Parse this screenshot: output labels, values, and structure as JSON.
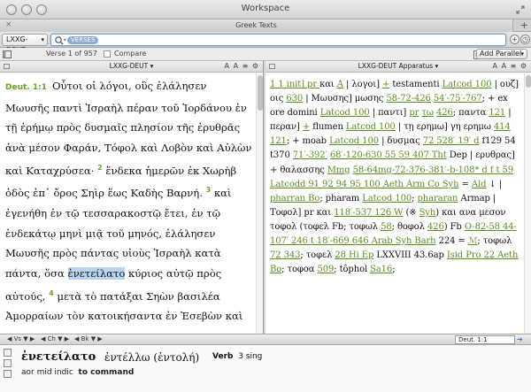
{
  "window": {
    "title": "Workspace",
    "tab_label": "Greek Texts",
    "tab_close": "×",
    "tab_add": "+"
  },
  "toolbar": {
    "resource": "LXXG-DEUT",
    "search_chip": "VERSES"
  },
  "status": {
    "verse_info": "Verse 1 of 957",
    "compare_label": "Compare",
    "add_parallel_label": "Add Parallel"
  },
  "left_pane": {
    "title": "LXXG-DEUT",
    "tools": "A A ≡ ⚙",
    "ref": "Deut. 1:1",
    "segments": [
      {
        "t": "Οὗτοι οἱ λόγοι, οὓς ἐλάλησεν Μωυσῆς"
      },
      {
        "t": "παντὶ Ἰσραὴλ πέραν τοῦ Ἰορδάνου ἐν τῇ"
      },
      {
        "t": "ἐρήμῳ πρὸς δυσμαῖς πλησίον τῆς ἐρυθρᾶς ἀνὰ"
      },
      {
        "t": "μέσον Φαράν, Τόφολ καὶ Λοβὸν καὶ Αὐλὼν"
      },
      {
        "t": "καὶ Καταχρύσεα·"
      }
    ],
    "verses": [
      {
        "n": "2",
        "t": "ἕνδεκα ἡμερῶν ἐκ Χωρὴβ ὁδὸς ἐπ᾽ ὄρος Σηὶρ ἕως Καδὴς Βαρνή."
      },
      {
        "n": "3",
        "t": "καὶ ἐγενήθη ἐν τῷ τεσσαρακοστῷ ἔτει, ἐν τῷ ἑνδεκάτῳ μηνὶ μιᾷ τοῦ μηνός, ἐλάλησεν Μωυσῆς πρὸς πάντας υἱοὺς Ἰσραὴλ κατὰ πάντα, ὅσα"
      },
      {
        "n": "",
        "t": "ἐνετείλατο",
        "highlight": true
      },
      {
        "n": "",
        "t": "κύριος αὐτῷ πρὸς αὐτούς,"
      },
      {
        "n": "4",
        "t": "μετὰ τὸ πατάξαι Σηὼν βασιλέα Ἀμορραίων τὸν κατοικήσαντα ἐν Ἐσεβὼν καὶ"
      }
    ]
  },
  "right_pane": {
    "title": "LXXG-DEUT Apparatus",
    "tools": "A A ≡ ⚙",
    "text_segments": [
      {
        "t": "1 1 init] ",
        "u": true
      },
      {
        "t": "pr ",
        "u": true
      },
      {
        "t": "και "
      },
      {
        "t": "A",
        "u": true
      },
      {
        "t": " | λογοι] "
      },
      {
        "t": "+",
        "u": true
      },
      {
        "t": " testamenti "
      },
      {
        "t": "Latcod 100",
        "u": true
      },
      {
        "t": " | ουζ] οις "
      },
      {
        "t": "630",
        "u": true
      },
      {
        "t": " | Μωυσης] μωσης "
      },
      {
        "t": "58-72-426",
        "u": true
      },
      {
        "t": " "
      },
      {
        "t": "54′-75′-767",
        "u": true
      },
      {
        "t": "; + ex ore domini "
      },
      {
        "t": "Latcod 100",
        "u": true
      },
      {
        "t": " | παντι] "
      },
      {
        "t": "pr",
        "u": true
      },
      {
        "t": " "
      },
      {
        "t": "τω",
        "u": true
      },
      {
        "t": " "
      },
      {
        "t": "426",
        "u": true
      },
      {
        "t": "; παντα "
      },
      {
        "t": "121",
        "u": true
      },
      {
        "t": " | περαν] "
      },
      {
        "t": "+",
        "u": true
      },
      {
        "t": " flumen "
      },
      {
        "t": "Latcod 100",
        "u": true
      },
      {
        "t": " | τῃ "
      },
      {
        "t": "ερημω] γη ερημω "
      },
      {
        "t": "414 121",
        "u": true
      },
      {
        "t": "; + moab "
      },
      {
        "t": "Latcod 100",
        "u": true
      },
      {
        "t": " | "
      },
      {
        "t": "δυσμας "
      },
      {
        "t": "72 528′ 19′ d",
        "u": true
      },
      {
        "t": " f129 54 t370 "
      },
      {
        "t": "71′-392′",
        "u": true
      },
      {
        "t": " "
      },
      {
        "t": "68′-120-630 55 59 407 Tht",
        "u": true
      },
      {
        "t": " Dep | ερυθρας] + "
      },
      {
        "t": "θαλασσης "
      },
      {
        "t": "Mmg",
        "u": true
      },
      {
        "t": " "
      },
      {
        "t": "58-64mg-72-376-381′-b-108* d f t 59",
        "u": true
      },
      {
        "t": " "
      },
      {
        "t": "Latcodd 91 92 94 95 100 Aeth Arm Co Syh",
        "u": true
      },
      {
        "t": " = "
      },
      {
        "t": "Ald",
        "u": true
      },
      {
        "t": " ↓ | "
      },
      {
        "t": "pharran Bo",
        "u": true
      },
      {
        "t": "; pharam "
      },
      {
        "t": "Latcod 100",
        "u": true
      },
      {
        "t": "; "
      },
      {
        "t": "phararan",
        "u": true
      },
      {
        "t": " Armap | "
      },
      {
        "t": "Τοφολ] pr και "
      },
      {
        "t": "118′-537 126 W",
        "u": true
      },
      {
        "t": " (※ "
      },
      {
        "t": "Syh",
        "u": true
      },
      {
        "t": ") και ανα "
      },
      {
        "t": "μεσον τοφολ (τοφελ Fb; τοφωλ "
      },
      {
        "t": "58",
        "u": true
      },
      {
        "t": "; θοφολ "
      },
      {
        "t": "426",
        "u": true
      },
      {
        "t": ") Fb "
      },
      {
        "t": "O-82-58 44-107′ 246 t 18′-669 646 Arab Syh Barh",
        "u": true
      },
      {
        "t": " 224 "
      },
      {
        "t": "= "
      },
      {
        "t": "ℳ",
        "u": true
      },
      {
        "t": "; τοφωλ "
      },
      {
        "t": "72 343",
        "u": true
      },
      {
        "t": "; τοφελ "
      },
      {
        "t": "28 Hi Ep",
        "u": true
      },
      {
        "t": " LXXVIII "
      },
      {
        "t": "43.6ap "
      },
      {
        "t": "Isid Pro 22 Aeth Bo",
        "u": true
      },
      {
        "t": "; τοφοα "
      },
      {
        "t": "509",
        "u": true
      },
      {
        "t": "; tôphol "
      },
      {
        "t": "Sa16",
        "u": true
      },
      {
        "t": ";"
      }
    ]
  },
  "navbar": {
    "items": [
      "◀ Vs ▼ ▶",
      "◀ Ch ▼ ▶",
      "◀ Bk ▼ ▶"
    ],
    "ref": "Deut. 1:1"
  },
  "info": {
    "word": "ἐνετείλατο",
    "lemma": "ἐντέλλω (ἐντολή)",
    "pos": "Verb",
    "person": "3 sing",
    "parse": "aor mid indic",
    "gloss": "to command"
  }
}
